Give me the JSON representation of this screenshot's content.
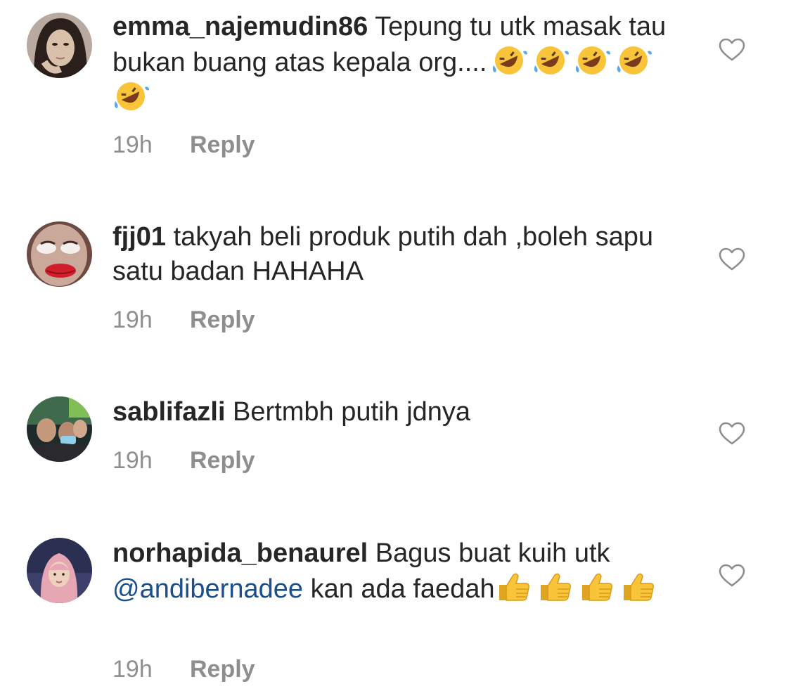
{
  "comments": [
    {
      "username": "emma_najemudin86",
      "text": " Tepung tu utk masak tau bukan buang atas kepala org....",
      "emoji_name": "rolling-on-floor-laughing-emoji",
      "emoji_count": 5,
      "time": "19h",
      "reply_label": "Reply"
    },
    {
      "username": "fjj01",
      "text": " takyah beli produk putih dah ,boleh sapu satu badan HAHAHA",
      "time": "19h",
      "reply_label": "Reply"
    },
    {
      "username": "sablifazli",
      "text": " Bertmbh putih jdnya",
      "time": "19h",
      "reply_label": "Reply"
    },
    {
      "username": "norhapida_benaurel",
      "text": " Bagus buat kuih utk ",
      "mention": "@andibernadee",
      "text_after": " kan ada faedah",
      "emoji_name": "thumbs-up-emoji",
      "emoji_count": 4,
      "time": "19h",
      "reply_label": "Reply"
    }
  ],
  "icons": {
    "like": "heart-outline-icon"
  },
  "colors": {
    "text": "#262626",
    "meta": "#8e8e8e",
    "mention": "#1a4f8a"
  }
}
